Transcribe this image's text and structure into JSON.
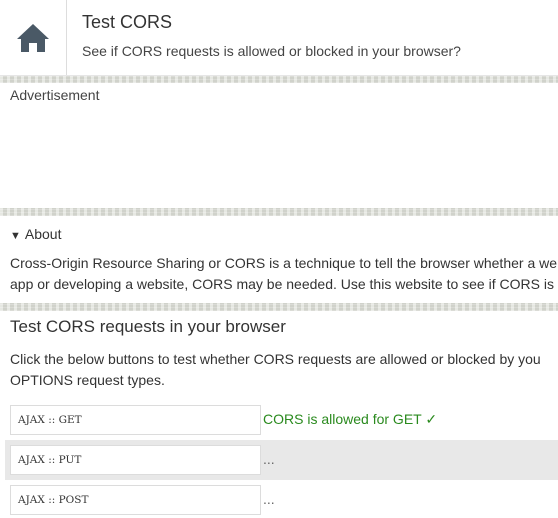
{
  "header": {
    "home_icon": "home-icon",
    "title": "Test CORS",
    "subtitle": "See if CORS requests is allowed or blocked in your browser?"
  },
  "ad": {
    "label": "Advertisement"
  },
  "about": {
    "toggle_label": "About",
    "toggle_icon": "triangle-down-icon",
    "lines": [
      "Cross-Origin Resource Sharing or CORS is a technique to tell the browser whether a we",
      "app or developing a website, CORS may be needed. Use this website to see if CORS is"
    ]
  },
  "test": {
    "heading": "Test CORS requests in your browser",
    "desc_lines": [
      "Click the below buttons to test whether CORS requests are allowed or blocked by you",
      "OPTIONS request types."
    ],
    "requests": [
      {
        "button_label": "AJAX :: GET",
        "status": "CORS is allowed for GET ✓"
      },
      {
        "button_label": "AJAX :: PUT",
        "status": "..."
      },
      {
        "button_label": "AJAX :: POST",
        "status": "..."
      }
    ]
  },
  "colors": {
    "success": "#2a8a1e",
    "row_shade": "#e8e8e8",
    "divider": "#d9dbd3",
    "home_icon": "#4a5966"
  }
}
